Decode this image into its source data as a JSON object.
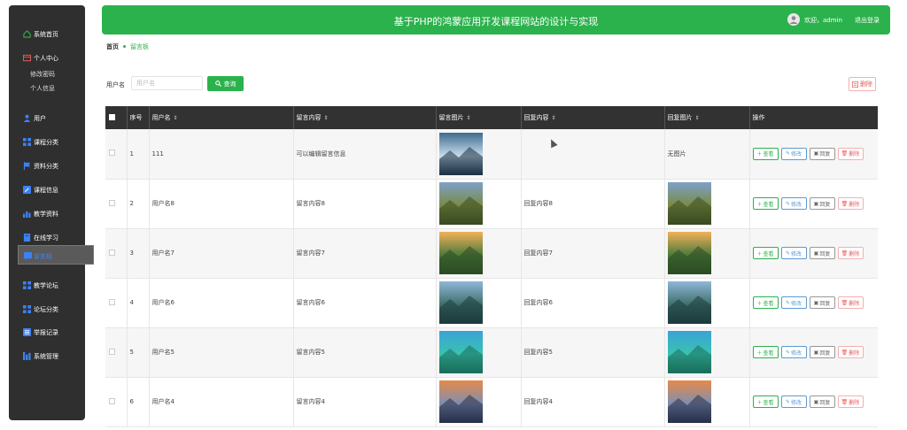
{
  "header": {
    "title": "基于PHP的鸿蒙应用开发课程网站的设计与实现",
    "welcome": "欢迎，admin",
    "logout": "退出登录"
  },
  "sidebar": {
    "items": [
      {
        "label": "系统首页",
        "icon": "home-icon"
      },
      {
        "label": "个人中心",
        "icon": "card-icon"
      },
      {
        "label": "用户",
        "icon": "user-icon"
      },
      {
        "label": "课程分类",
        "icon": "grid-icon"
      },
      {
        "label": "资料分类",
        "icon": "flag-icon"
      },
      {
        "label": "课程信息",
        "icon": "edit-icon"
      },
      {
        "label": "教学资料",
        "icon": "chart-icon"
      },
      {
        "label": "在线学习",
        "icon": "book-icon"
      },
      {
        "label": "留言板",
        "icon": "message-icon"
      },
      {
        "label": "教学论坛",
        "icon": "grid-icon"
      },
      {
        "label": "论坛分类",
        "icon": "grid-icon"
      },
      {
        "label": "举报记录",
        "icon": "list-icon"
      },
      {
        "label": "系统管理",
        "icon": "stats-icon"
      }
    ],
    "sub_items": [
      "修改密码",
      "个人信息"
    ]
  },
  "breadcrumb": {
    "home": "首页",
    "current": "留言板"
  },
  "search": {
    "label": "用户名",
    "placeholder": "用户名",
    "button": "查询"
  },
  "toolbar": {
    "delete": "删除"
  },
  "table": {
    "headers": [
      "序号",
      "用户名",
      "留言内容",
      "留言图片",
      "回复内容",
      "回复图片",
      "操作"
    ],
    "rows": [
      {
        "index": "1",
        "username": "111",
        "message": "可以编辑留言信息",
        "reply": "",
        "reply_image": "无图片"
      },
      {
        "index": "2",
        "username": "用户名8",
        "message": "留言内容8",
        "reply": "回复内容8",
        "reply_image": ""
      },
      {
        "index": "3",
        "username": "用户名7",
        "message": "留言内容7",
        "reply": "回复内容7",
        "reply_image": ""
      },
      {
        "index": "4",
        "username": "用户名6",
        "message": "留言内容6",
        "reply": "回复内容6",
        "reply_image": ""
      },
      {
        "index": "5",
        "username": "用户名5",
        "message": "留言内容5",
        "reply": "回复内容5",
        "reply_image": ""
      },
      {
        "index": "6",
        "username": "用户名4",
        "message": "留言内容4",
        "reply": "回复内容4",
        "reply_image": ""
      }
    ],
    "actions": {
      "view": "查看",
      "edit": "修改",
      "reply": "回复",
      "delete": "删除"
    }
  },
  "colors": {
    "primary": "#2bb24c",
    "sidebar": "#2f2f2f",
    "table_header": "#323232",
    "danger": "#e85a5a",
    "info": "#5b9bd5"
  }
}
